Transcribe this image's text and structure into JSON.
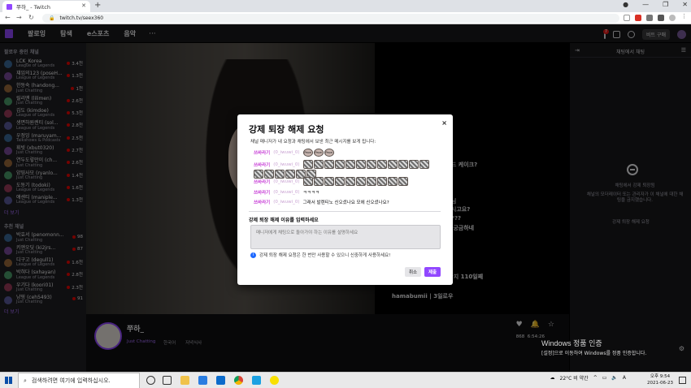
{
  "browser": {
    "tab_title": "쭈하_ - Twitch",
    "url": "twitch.tv/seex360"
  },
  "twitch_nav": {
    "following": "팔로잉",
    "browse": "탐색",
    "esports": "e스포츠",
    "music": "음악",
    "more": "···",
    "notif_count": "7",
    "get_bits": "비트 구매"
  },
  "sidebar": {
    "section_followed": "팔로우 중인 채널",
    "channels": [
      {
        "name": "LCK_Korea",
        "game": "League of Legends",
        "viewers": "3.4천"
      },
      {
        "name": "쟤임의123 (poseH...",
        "game": "League of Legends",
        "viewers": "1.3천"
      },
      {
        "name": "한동숙 (handong...",
        "game": "Just Chatting",
        "viewers": "1천"
      },
      {
        "name": "릴리맨 (lilimen)",
        "game": "Just Chatting",
        "viewers": "2.6천"
      },
      {
        "name": "김도 (kimdoe)",
        "game": "League of Legends",
        "viewers": "5.3천"
      },
      {
        "name": "생면하원렌티 (sol...",
        "game": "League of Legends",
        "viewers": "2.8천"
      },
      {
        "name": "우정잉 (maruyam...",
        "game": "Talkshows & Podcasts",
        "viewers": "2.5천"
      },
      {
        "name": "휘빗 (xbut0320)",
        "game": "Just Chatting",
        "viewers": "2.7천"
      },
      {
        "name": "연두도렇만이 (ch...",
        "game": "Just Chatting",
        "viewers": "2.6천"
      },
      {
        "name": "양띵사모 (ryanlo...",
        "game": "Just Chatting",
        "viewers": "1.4천"
      },
      {
        "name": "도동기 (todoki)",
        "game": "League of Legends",
        "viewers": "1.6천"
      },
      {
        "name": "얘센티 (maniple...",
        "game": "League of Legends",
        "viewers": "1.3천"
      }
    ],
    "more_1": "더 보기",
    "section_recommended": "추천 채널",
    "recommended": [
      {
        "name": "박효서 (penomonn...",
        "game": "Just Chatting",
        "viewers": "98"
      },
      {
        "name": "키앤오딧 (ki2jrs...",
        "game": "Just Chatting",
        "viewers": "87"
      },
      {
        "name": "디구고 (degull1)",
        "game": "League of Legends",
        "viewers": "1.6천"
      },
      {
        "name": "박혀다 (sxhayan)",
        "game": "League of Legends",
        "viewers": "2.8천"
      },
      {
        "name": "우기다 (koori01)",
        "game": "Just Chatting",
        "viewers": "2.3천"
      },
      {
        "name": "냥핑 (ceh5493)",
        "game": "Just Chatting",
        "viewers": "91"
      }
    ],
    "more_2": "더 보기"
  },
  "stream": {
    "streamer": "쭈하_",
    "game": "Just Chatting",
    "tag1": "한국어",
    "tag2": "저녁식사",
    "uptime": "6:54:26",
    "viewers": "868"
  },
  "chat": {
    "header": "채팅에서 채팅",
    "notice": "채팅에서 강제 퇴장됨",
    "notice_detail": "채널의 모더레이터 또는 관리자가 이 채널에 대한 채팅을 금지했습니다.",
    "unban_button": "강제 퇴장 해제 요청"
  },
  "behind_chat": [
    "스피드 케이크?",
    "안녕님",
    "솔미시고요?",
    "는데???",
    "힐킥 궁금하네",
    "쿠하",
    "ndn",
    "양님이 쭈하님을 팔로우한지 110일째",
    "hamabumii | 3일로우"
  ],
  "modal": {
    "title": "강제 퇴장 해제 요청",
    "close": "×",
    "description": "채널 매니저가 내 요청과 채팅에서 보낸 최근 메시지를 보게 됩니다:",
    "messages": [
      {
        "user": "쓰바라기",
        "id": "(0_iwuwi_0)",
        "text": ""
      },
      {
        "user": "쓰바라기",
        "id": "(0_iwuwi_0)",
        "text": ""
      },
      {
        "user": "쓰바라기",
        "id": "(0_iwuwi_0)",
        "text": ""
      },
      {
        "user": "쓰바라기",
        "id": "(0_iwuwi_0)",
        "text": "ㅋㅋㅋㅋ"
      },
      {
        "user": "쓰바라기",
        "id": "(0_iwuwi_0)",
        "text": "그래서 발렌티노 신오셨나요 모에 신오셨나요?"
      }
    ],
    "emote_label": "Pepe",
    "reason_label": "강제 퇴장 해제 이유를 입력하세요",
    "reason_placeholder": "매니저에게 채팅으로 돌아가야 하는 이유를 설명하세요",
    "info_text": "강제 퇴장 해제 요청은 한 번만 사용할 수 있으니 신중하게 사용하세요!",
    "cancel": "취소",
    "submit": "제출"
  },
  "windows": {
    "watermark_title": "Windows 정품 인증",
    "watermark_sub": "[설정]으로 이동하여 Windows를 정품 인증합니다.",
    "search_placeholder": "검색하려면 여기에 입력하십시오.",
    "weather": "22°C 비 약간",
    "ime": "A",
    "time": "오후 9:54",
    "date": "2021-06-23"
  }
}
